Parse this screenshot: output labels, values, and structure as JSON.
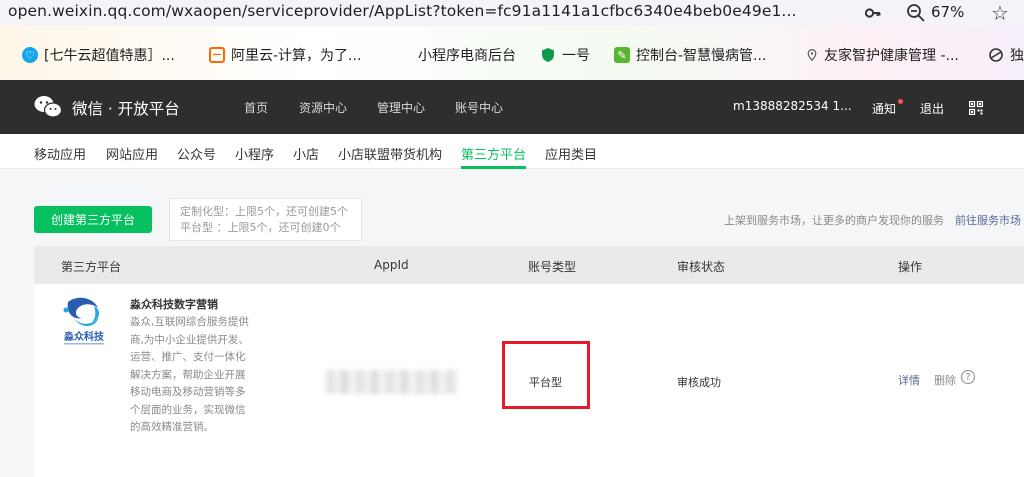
{
  "browser": {
    "url": "open.weixin.qq.com/wxaopen/serviceprovider/AppList?token=fc91a1141a1cfbc6340e4beb0e49e1...",
    "zoom": "67%",
    "bookmarks": [
      {
        "label": "[七牛云超值特惠］...",
        "icon": "qiniu-icon",
        "color": "#13a6ef"
      },
      {
        "label": "阿里云-计算，为了...",
        "icon": "aliyun-icon",
        "color": "#ff6a00"
      },
      {
        "label": "小程序电商后台",
        "icon": "",
        "color": ""
      },
      {
        "label": "一号",
        "icon": "shield-icon",
        "color": "#0d9a4c"
      },
      {
        "label": "控制台-智慧慢病管...",
        "icon": "leaf-icon",
        "color": "#5cb531"
      },
      {
        "label": "友家智护健康管理 -...",
        "icon": "location-pin-icon",
        "color": "#555555"
      },
      {
        "label": "独",
        "icon": "globe-icon",
        "color": "#333333"
      }
    ]
  },
  "topnav": {
    "brand": "微信 · 开放平台",
    "items": [
      "首页",
      "资源中心",
      "管理中心",
      "账号中心"
    ],
    "account": "m13888282534 1...",
    "notice": "通知",
    "logout": "退出"
  },
  "subnav": {
    "items": [
      "移动应用",
      "网站应用",
      "公众号",
      "小程序",
      "小店",
      "小店联盟带货机构",
      "第三方平台",
      "应用类目"
    ],
    "active_index": 6
  },
  "main": {
    "create_button": "创建第三方平台",
    "tip_line1": "定制化型：上限5个，还可创建5个",
    "tip_line2": "平台型 ：上限5个，还可创建0个",
    "market_tip": "上架到服务市场，让更多的商户发现你的服务",
    "market_link": "前往服务市场"
  },
  "table": {
    "headers": [
      "第三方平台",
      "AppId",
      "账号类型",
      "审核状态",
      "操作"
    ],
    "rows": [
      {
        "logo_text": "淼众科技",
        "name": "淼众科技数字营销",
        "description": "淼众,互联网综合服务提供商,为中小企业提供开发、运营、推广、支付一体化解决方案，帮助企业开展移动电商及移动营销等多个层面的业务，实现微信的高效精准营销。",
        "account_type": "平台型",
        "audit_status": "审核成功",
        "detail": "详情",
        "delete": "删除",
        "help": "?"
      }
    ]
  },
  "colors": {
    "brand_green": "#07c160",
    "link_blue": "#576b95",
    "nav_bg": "#2e2e2e",
    "highlight_red": "#e8192c"
  }
}
